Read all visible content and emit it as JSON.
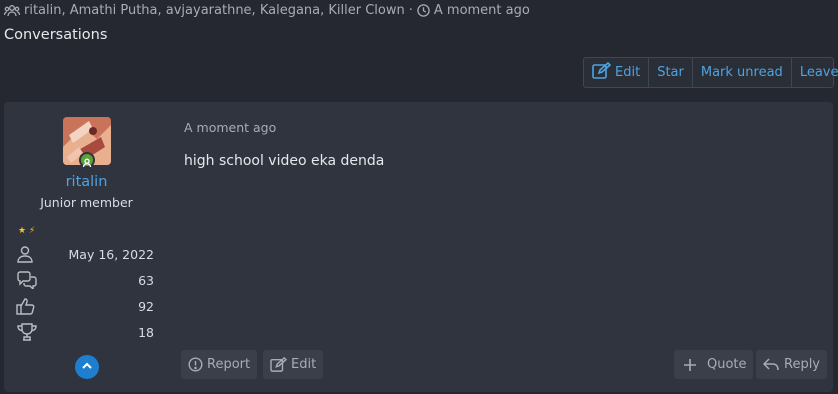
{
  "meta": {
    "participants": "ritalin, Amathi Putha, avjayarathne, Kalegana, Killer Clown",
    "separator": "·",
    "time": "A moment ago",
    "participants_icon": "users-icon",
    "time_icon": "clock-icon"
  },
  "page": {
    "title": "Conversations"
  },
  "toolbar": {
    "edit": "Edit",
    "star": "Star",
    "mark_unread": "Mark unread",
    "leave": "Leave"
  },
  "message": {
    "user": {
      "name": "ritalin",
      "title": "Junior member",
      "stars": "★ ⚡",
      "stats": [
        {
          "icon": "user-icon",
          "value": "May 16, 2022"
        },
        {
          "icon": "messages-icon",
          "value": "63"
        },
        {
          "icon": "thumbs-up-icon",
          "value": "92"
        },
        {
          "icon": "trophy-icon",
          "value": "18"
        }
      ]
    },
    "time": "A moment ago",
    "body": "high school video eka denda",
    "actions": {
      "report": "Report",
      "edit": "Edit",
      "quote": "Quote",
      "reply": "Reply"
    }
  },
  "colors": {
    "background": "#252830",
    "panel": "#30343e",
    "accent": "#4fa3e0",
    "online": "#5aa336"
  }
}
